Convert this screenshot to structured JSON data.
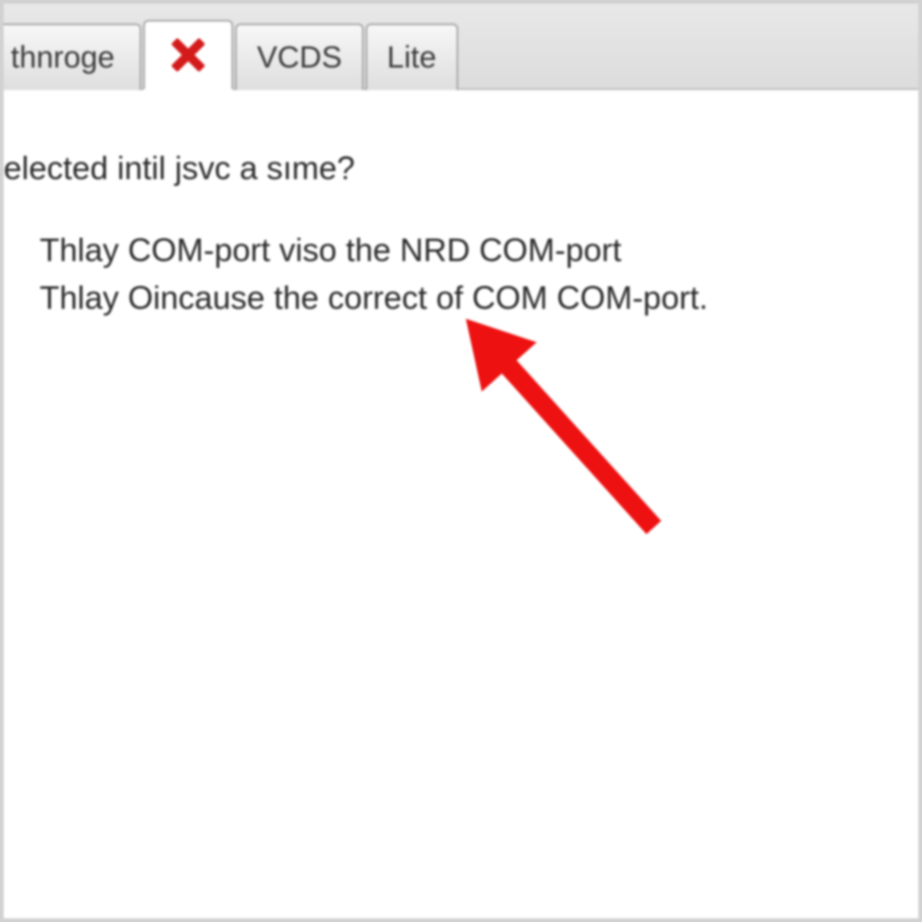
{
  "tabs": {
    "first_partial": "thnroge",
    "vcds": "VCDS",
    "lite": "Lite"
  },
  "content": {
    "heading_partial": "elected intil jsvc a sıme?",
    "line1": "Thlay COM-port viso the NRD COM-port",
    "line2": "Thlay Oincause the correct of COM COM-port."
  },
  "colors": {
    "arrow": "#ee1111",
    "close_icon": "#d41b1b"
  }
}
